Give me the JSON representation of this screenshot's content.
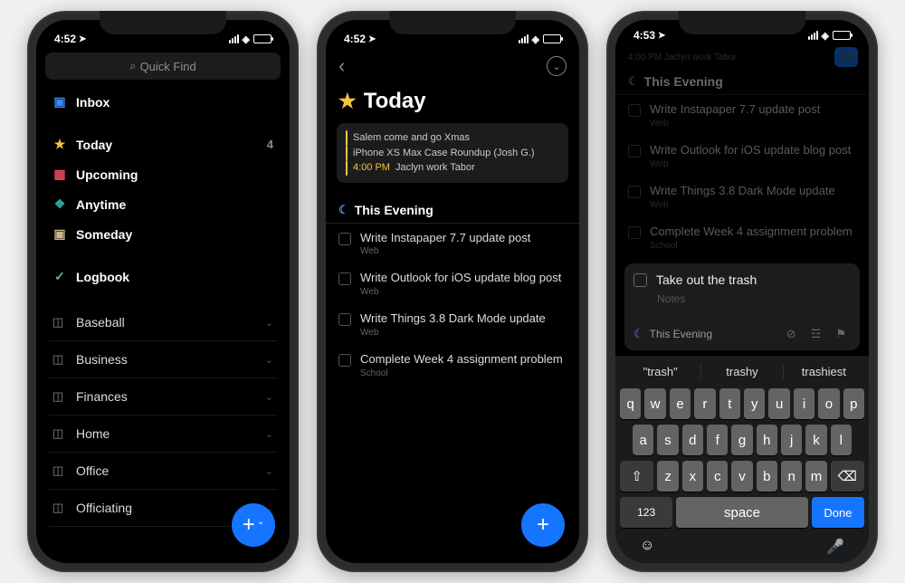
{
  "status": {
    "time1": "4:52",
    "time2": "4:52",
    "time3": "4:53"
  },
  "screen1": {
    "search_placeholder": "Quick Find",
    "nav": [
      {
        "icon": "📥",
        "color": "#3a88f0",
        "label": "Inbox"
      },
      {
        "icon": "★",
        "color": "#f4c63b",
        "label": "Today",
        "badge": "4"
      },
      {
        "icon": "▦",
        "color": "#e24a5c",
        "label": "Upcoming"
      },
      {
        "icon": "❖",
        "color": "#2fa39a",
        "label": "Anytime"
      },
      {
        "icon": "▣",
        "color": "#c8b488",
        "label": "Someday"
      }
    ],
    "logbook": {
      "icon": "✓",
      "color": "#4cc07c",
      "label": "Logbook"
    },
    "areas": [
      "Baseball",
      "Business",
      "Finances",
      "Home",
      "Office",
      "Officiating"
    ]
  },
  "screen2": {
    "title": "Today",
    "box_lines": [
      {
        "bar": "yellow",
        "text": "Salem come and go Xmas"
      },
      {
        "bar": "yellow",
        "text": "iPhone XS Max Case Roundup (Josh G.)"
      },
      {
        "bar": "yellow",
        "time": "4:00 PM",
        "text": "Jaclyn work Tabor"
      }
    ],
    "section": "This Evening",
    "tasks": [
      {
        "title": "Write Instapaper 7.7 update post",
        "sub": "Web"
      },
      {
        "title": "Write Outlook for iOS update blog post",
        "sub": "Web"
      },
      {
        "title": "Write Things 3.8 Dark Mode update",
        "sub": "Web"
      },
      {
        "title": "Complete Week 4 assignment problem",
        "sub": "School"
      }
    ]
  },
  "screen3": {
    "top_time": "4:00 PM",
    "top_text": "Jaclyn work Tabor",
    "section": "This Evening",
    "tasks": [
      {
        "title": "Write Instapaper 7.7 update post",
        "sub": "Web"
      },
      {
        "title": "Write Outlook for iOS update blog post",
        "sub": "Web"
      },
      {
        "title": "Write Things 3.8 Dark Mode update",
        "sub": "Web"
      },
      {
        "title": "Complete Week 4 assignment problem",
        "sub": "School"
      }
    ],
    "new_task": "Take out the trash",
    "notes_ph": "Notes",
    "card_section": "This Evening",
    "suggestions": [
      "\"trash\"",
      "trashy",
      "trashiest"
    ],
    "row1": [
      "q",
      "w",
      "e",
      "r",
      "t",
      "y",
      "u",
      "i",
      "o",
      "p"
    ],
    "row2": [
      "a",
      "s",
      "d",
      "f",
      "g",
      "h",
      "j",
      "k",
      "l"
    ],
    "row3": [
      "z",
      "x",
      "c",
      "v",
      "b",
      "n",
      "m"
    ],
    "num": "123",
    "space": "space",
    "done": "Done"
  }
}
